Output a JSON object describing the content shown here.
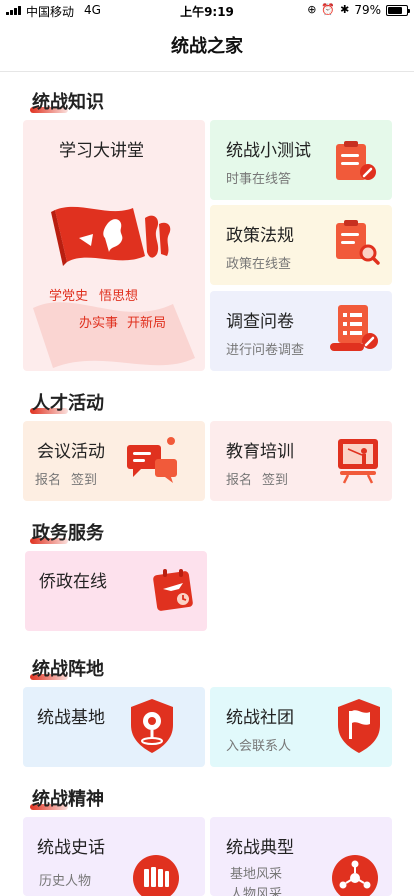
{
  "status_bar": {
    "carrier": "中国移动",
    "network": "4G",
    "time": "上午9:19",
    "battery": "79%",
    "battery_level": 0.79
  },
  "header": {
    "title": "统战之家"
  },
  "sections": {
    "knowledge": {
      "title": "统战知识",
      "lecture": {
        "title": "学习大讲堂",
        "slogan1": "学党史",
        "slogan2": "悟思想",
        "slogan3": "办实事",
        "slogan4": "开新局"
      },
      "quiz": {
        "title": "统战小测试",
        "sub": "时事在线答"
      },
      "policy": {
        "title": "政策法规",
        "sub": "政策在线查"
      },
      "survey": {
        "title": "调查问卷",
        "sub": "进行问卷调查"
      }
    },
    "talent": {
      "title": "人才活动",
      "meeting": {
        "title": "会议活动",
        "sub": "报名",
        "sub2": "签到"
      },
      "training": {
        "title": "教育培训",
        "sub": "报名",
        "sub2": "签到"
      }
    },
    "gov": {
      "title": "政务服务",
      "overseas": {
        "title": "侨政在线"
      }
    },
    "base": {
      "title": "统战阵地",
      "site": {
        "title": "统战基地"
      },
      "club": {
        "title": "统战社团",
        "sub": "入会联系人"
      }
    },
    "spirit": {
      "title": "统战精神",
      "history": {
        "title": "统战史话",
        "sub": "历史人物"
      },
      "model": {
        "title": "统战典型",
        "sub": "基地风采",
        "sub2": "人物风采"
      }
    }
  },
  "colors": {
    "accent": "#e0311f",
    "text": "#222222",
    "subtext": "#777777"
  }
}
